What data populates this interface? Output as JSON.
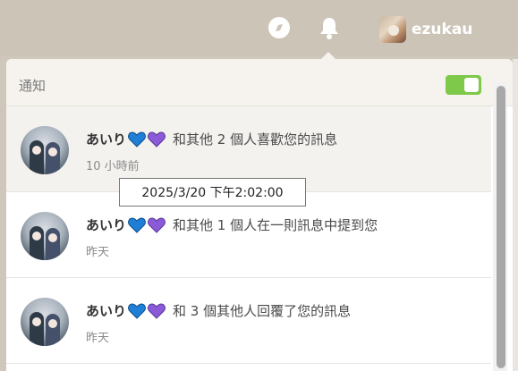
{
  "topbar": {
    "icons": [
      "compass-icon",
      "bell-icon"
    ],
    "username": "ezukau"
  },
  "panel": {
    "title": "通知",
    "toggle_on": true
  },
  "notifications": [
    {
      "name": "あいり",
      "hearts": [
        "blue-heart-icon",
        "purple-heart-icon"
      ],
      "message": "和其他 2 個人喜歡您的訊息",
      "time": "10 小時前"
    },
    {
      "name": "あいり",
      "hearts": [
        "blue-heart-icon",
        "purple-heart-icon"
      ],
      "message": "和其他 1 個人在一則訊息中提到您",
      "time": "昨天"
    },
    {
      "name": "あいり",
      "hearts": [
        "blue-heart-icon",
        "purple-heart-icon"
      ],
      "message": "和 3 個其他人回覆了您的訊息",
      "time": "昨天"
    }
  ],
  "tooltip": "2025/3/20 下午2:02:00",
  "colors": {
    "toggle_green": "#7ec84a",
    "blue_heart": "#1f7fd6",
    "purple_heart": "#8a5ad8"
  }
}
